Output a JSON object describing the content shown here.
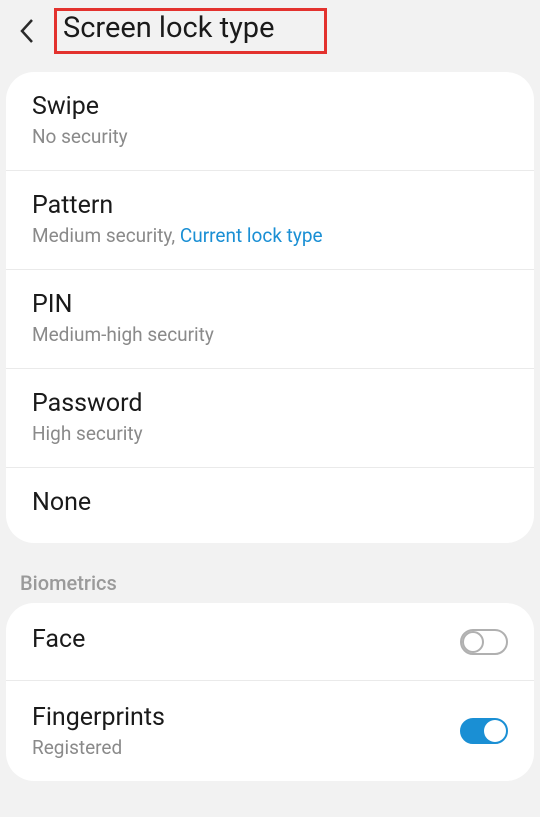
{
  "header": {
    "title": "Screen lock type"
  },
  "lockTypes": [
    {
      "title": "Swipe",
      "sub": "No security",
      "accent": ""
    },
    {
      "title": "Pattern",
      "sub": "Medium security, ",
      "accent": "Current lock type"
    },
    {
      "title": "PIN",
      "sub": "Medium-high security",
      "accent": ""
    },
    {
      "title": "Password",
      "sub": "High security",
      "accent": ""
    },
    {
      "title": "None",
      "sub": "",
      "accent": ""
    }
  ],
  "biometricsHeader": "Biometrics",
  "biometrics": [
    {
      "title": "Face",
      "sub": "",
      "on": false
    },
    {
      "title": "Fingerprints",
      "sub": "Registered",
      "on": true
    }
  ]
}
